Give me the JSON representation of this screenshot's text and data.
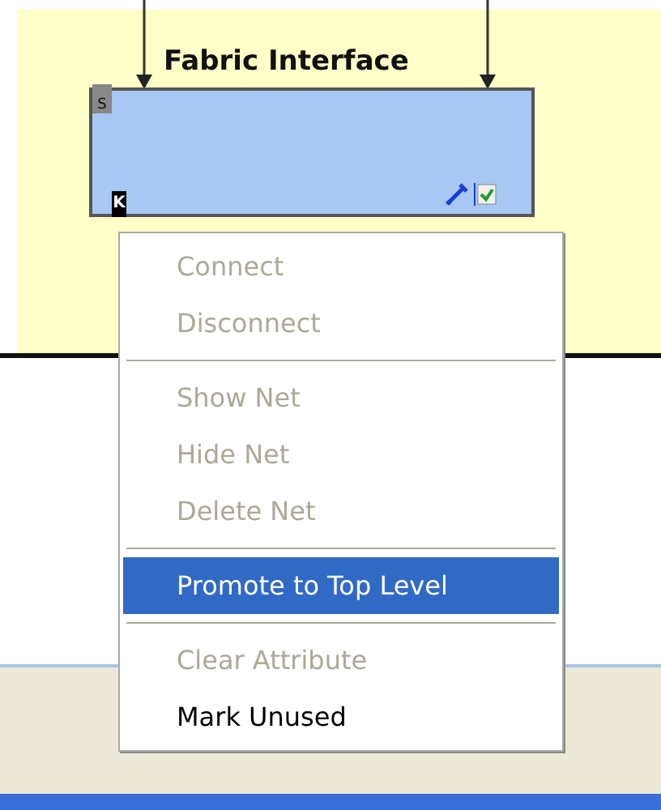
{
  "block": {
    "title": "Fabric Interface",
    "port_top": "S",
    "port_bottom": "K"
  },
  "context_menu": [
    {
      "kind": "item",
      "label": "Connect",
      "disabled": true,
      "selected": false
    },
    {
      "kind": "item",
      "label": "Disconnect",
      "disabled": true,
      "selected": false
    },
    {
      "kind": "separator"
    },
    {
      "kind": "item",
      "label": "Show Net",
      "disabled": true,
      "selected": false
    },
    {
      "kind": "item",
      "label": "Hide Net",
      "disabled": true,
      "selected": false
    },
    {
      "kind": "item",
      "label": "Delete Net",
      "disabled": true,
      "selected": false
    },
    {
      "kind": "separator"
    },
    {
      "kind": "item",
      "label": "Promote to Top Level",
      "disabled": false,
      "selected": true
    },
    {
      "kind": "separator"
    },
    {
      "kind": "item",
      "label": "Clear Attribute",
      "disabled": true,
      "selected": false
    },
    {
      "kind": "item",
      "label": "Mark Unused",
      "disabled": false,
      "selected": false
    }
  ]
}
